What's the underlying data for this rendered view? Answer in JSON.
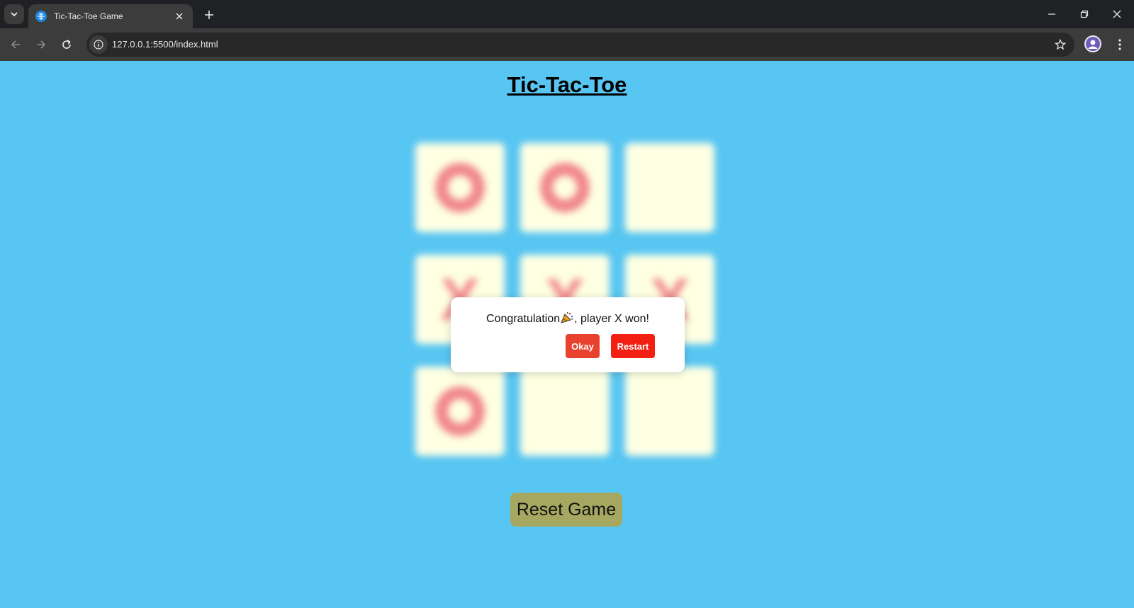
{
  "browser": {
    "tab_title": "Tic-Tac-Toe Game",
    "url": "127.0.0.1:5500/index.html"
  },
  "page": {
    "title": "Tic-Tac-Toe",
    "reset_label": "Reset Game"
  },
  "board": {
    "cells": [
      "O",
      "O",
      "",
      "X",
      "X",
      "X",
      "O",
      "",
      ""
    ]
  },
  "modal": {
    "message_before": "Congratulation",
    "message_after": ", player X won!",
    "icon": "party-popper-icon",
    "okay_label": "Okay",
    "restart_label": "Restart"
  },
  "colors": {
    "page_background": "#58c6f2",
    "cell_background": "#feffe3",
    "mark_color": "#f1888e",
    "reset_button": "#a6a861",
    "okay_button": "#e8412d",
    "restart_button": "#f21f12"
  }
}
